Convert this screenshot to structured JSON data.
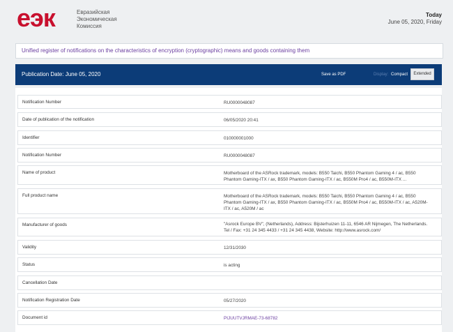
{
  "header": {
    "logo_mark": "еэк",
    "org_lines": [
      "Евразийская",
      "Экономическая",
      "Комиссия"
    ],
    "today_label": "Today",
    "today_date": "June 05, 2020, Friday"
  },
  "register_title": "Unified register of notifications on the characteristics of encryption (cryptographic) means and goods containing them",
  "toolbar": {
    "publication": "Publication Date: June 05, 2020",
    "save_pdf": "Save as PDF",
    "display_label": "Display:",
    "compact": "Compact",
    "extended": "Extended"
  },
  "rows": [
    {
      "label": "Notification Number",
      "value": "RU0000048087"
    },
    {
      "label": "Date of publication of the notification",
      "value": "06/05/2020 20:41"
    },
    {
      "label": "Identifier",
      "value": "010000001000"
    },
    {
      "label": "Notification Number",
      "value": "RU0000048087"
    },
    {
      "label": "Name of product",
      "value": "Motherboard of the ASRock trademark, models: B550 Taichi, B550 Phantom Gaming 4 / ac, B550 Phantom Gaming-ITX / ax, B550 Phantom Gaming-ITX / ac, B550M Pro4 / ac, B550M-ITX ..."
    },
    {
      "label": "Full product name",
      "value": "Motherboard of the ASRock trademark, models: B550 Taichi, B550 Phantom Gaming 4 / ac, B550 Phantom Gaming-ITX / ax, B550 Phantom Gaming-ITX / ac, B550M Pro4 / ac, B550M-ITX / ac, A520M-ITX / ac, A520M / ac"
    },
    {
      "label": "Manufacturer of goods",
      "value": "\"Asrock Europe BV\", (Netherlands), Address: Bijsterhuizen 11-11, 6546 AR Nijmegen, The Netherlands. Tel / Fax: +31 24 345 4433 / +31 24 345 4438, Website: http://www.asrock.com/"
    },
    {
      "label": "Validity",
      "value": "12/31/2030"
    },
    {
      "label": "Status",
      "value": "is acting"
    },
    {
      "label": "Cancellation Date",
      "value": ""
    },
    {
      "label": "Notification Registration Date",
      "value": "05/27/2020"
    },
    {
      "label": "Document id",
      "value": "PIJUUTVJRMAE-73-68782"
    }
  ]
}
